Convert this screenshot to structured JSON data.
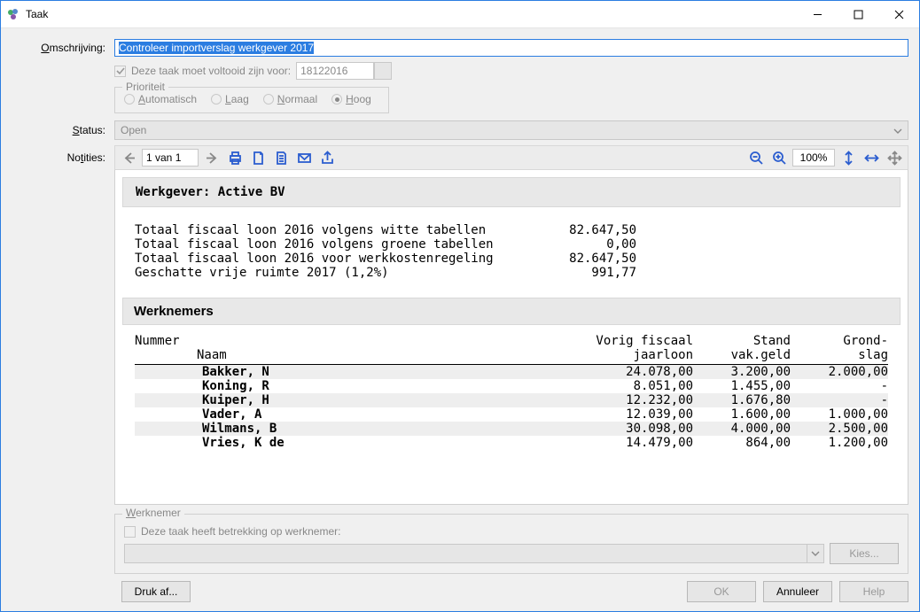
{
  "window": {
    "title": "Taak"
  },
  "labels": {
    "omschrijving_pre": "O",
    "omschrijving_post": "mschrijving:",
    "deadline_label": "Deze taak moet voltooid zijn voor:",
    "prioriteit": "Prioriteit",
    "status_pre": "S",
    "status_post": "tatus:",
    "notities_pre": "No",
    "notities_mid": "t",
    "notities_post": "ities:"
  },
  "omschrijving": {
    "value": "Controleer importverslag werkgever 2017"
  },
  "deadline": {
    "value": "18122016"
  },
  "priority": {
    "items": [
      {
        "pre": "A",
        "post": "utomatisch",
        "checked": false
      },
      {
        "pre": "L",
        "post": "aag",
        "checked": false
      },
      {
        "pre": "N",
        "post": "ormaal",
        "checked": false
      },
      {
        "pre": "H",
        "post": "oog",
        "checked": true
      }
    ]
  },
  "status": {
    "value": "Open"
  },
  "toolbar": {
    "pager": "1 van 1",
    "zoom": "100%"
  },
  "report": {
    "header_prefix": "Werkgever: ",
    "header_value": "Active BV",
    "totals": [
      {
        "label": "Totaal fiscaal loon 2016 volgens witte tabellen",
        "value": "82.647,50"
      },
      {
        "label": "Totaal fiscaal loon 2016 volgens groene tabellen",
        "value": "0,00"
      },
      {
        "label": "Totaal fiscaal loon 2016 voor werkkostenregeling",
        "value": "82.647,50"
      },
      {
        "label": "Geschatte vrije ruimte 2017 (1,2%)",
        "value": "991,77"
      }
    ],
    "section_title": "Werknemers",
    "columns": {
      "nummer": "Nummer",
      "naam": "Naam",
      "c1a": "Vorig fiscaal",
      "c1b": "jaarloon",
      "c2a": "Stand",
      "c2b": "vak.geld",
      "c3a": "Grond-",
      "c3b": "slag"
    },
    "rows": [
      {
        "naam": "Bakker, N",
        "c1": "24.078,00",
        "c2": "3.200,00",
        "c3": "2.000,00"
      },
      {
        "naam": "Koning, R",
        "c1": "8.051,00",
        "c2": "1.455,00",
        "c3": "-"
      },
      {
        "naam": "Kuiper, H",
        "c1": "12.232,00",
        "c2": "1.676,80",
        "c3": "-"
      },
      {
        "naam": "Vader, A",
        "c1": "12.039,00",
        "c2": "1.600,00",
        "c3": "1.000,00"
      },
      {
        "naam": "Wilmans, B",
        "c1": "30.098,00",
        "c2": "4.000,00",
        "c3": "2.500,00"
      },
      {
        "naam": "Vries, K de",
        "c1": "14.479,00",
        "c2": "864,00",
        "c3": "1.200,00"
      }
    ]
  },
  "werknemer_box": {
    "legend_pre": "W",
    "legend_post": "erknemer",
    "chk_label": "Deze taak heeft betrekking op werknemer:",
    "kies": "Kies..."
  },
  "footer": {
    "druk_pre": "D",
    "druk_post": "ruk af...",
    "ok": "OK",
    "annuleer": "Annuleer",
    "help": "Help"
  }
}
